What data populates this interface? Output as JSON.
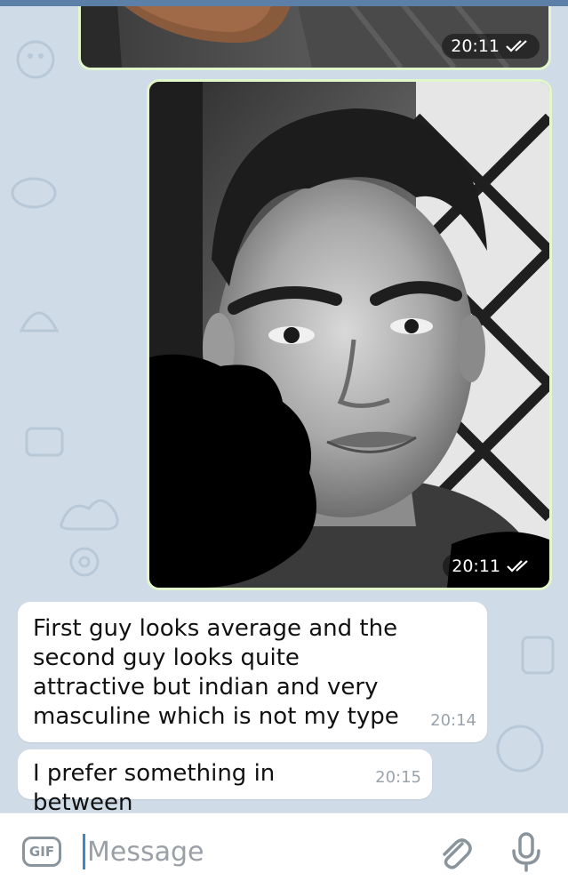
{
  "messages": [
    {
      "type": "photo",
      "direction": "outgoing",
      "time": "20:11",
      "status": "read",
      "description": "partial-photo"
    },
    {
      "type": "photo",
      "direction": "outgoing",
      "time": "20:11",
      "status": "read",
      "description": "portrait-photo"
    },
    {
      "type": "text",
      "direction": "incoming",
      "text": "First guy looks average and the second guy looks quite attractive but indian and very masculine which is not my type",
      "time": "20:14"
    },
    {
      "type": "text",
      "direction": "incoming",
      "text": "I prefer something in between",
      "time": "20:15"
    }
  ],
  "input_bar": {
    "gif_label": "GIF",
    "placeholder": "Message",
    "icons": [
      "gif-icon",
      "attach-icon",
      "mic-icon"
    ]
  },
  "colors": {
    "chat_background": "#cfdbe6",
    "outgoing_bubble": "#e2f7cb",
    "incoming_bubble": "#ffffff",
    "accent": "#3f86c5"
  }
}
